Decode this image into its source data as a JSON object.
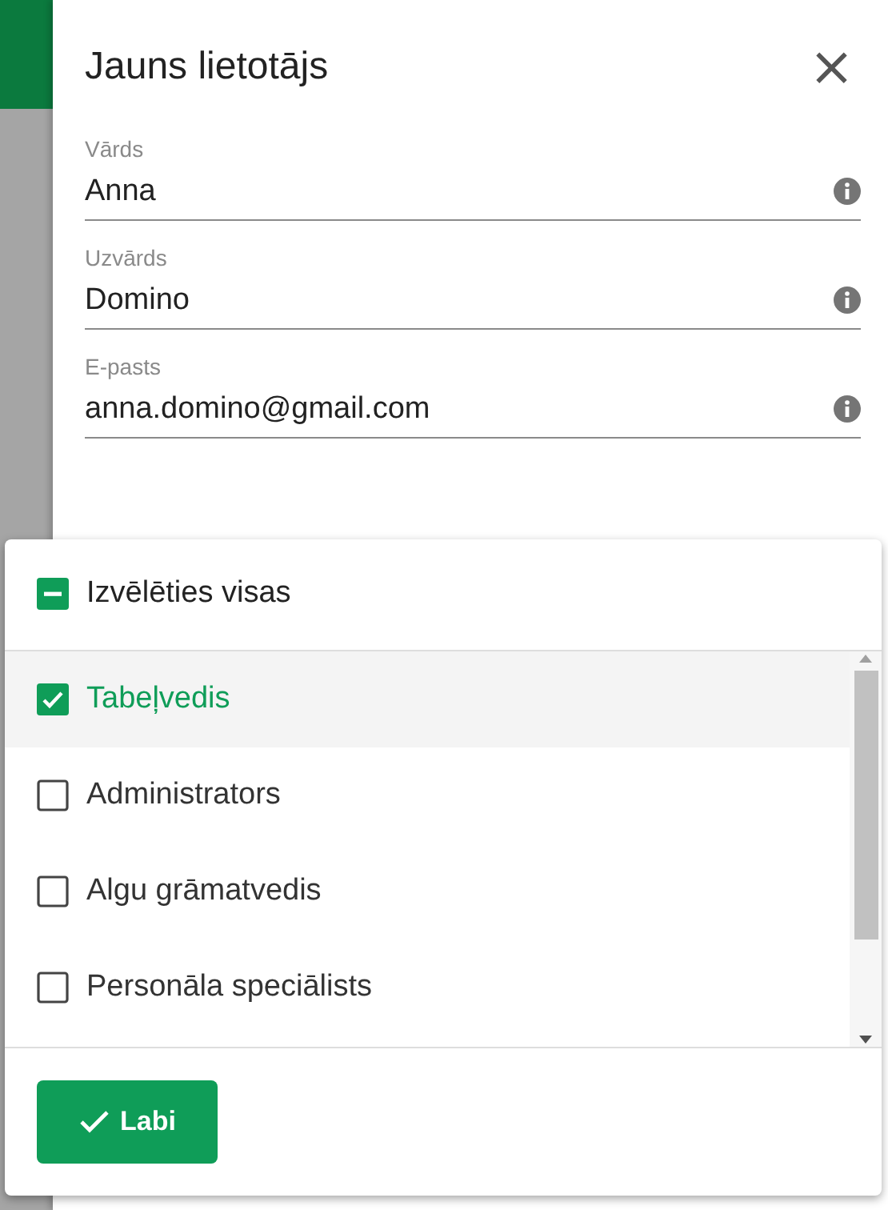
{
  "dialog": {
    "title": "Jauns lietotājs",
    "close": "×"
  },
  "fields": [
    {
      "label": "Vārds",
      "value": "Anna"
    },
    {
      "label": "Uzvārds",
      "value": "Domino"
    },
    {
      "label": "E-pasts",
      "value": "anna.domino@gmail.com"
    }
  ],
  "dropdown": {
    "select_all": {
      "label": "Izvēlēties visas",
      "checked": false,
      "indeterminate": true
    },
    "options": [
      {
        "label": "Tabeļvedis",
        "checked": true,
        "selected": true
      },
      {
        "label": "Administrators",
        "checked": false,
        "selected": false
      },
      {
        "label": "Algu grāmatvedis",
        "checked": false,
        "selected": false
      },
      {
        "label": "Personāla speciālists",
        "checked": false,
        "selected": false
      }
    ],
    "button": {
      "label": "Labi"
    }
  }
}
